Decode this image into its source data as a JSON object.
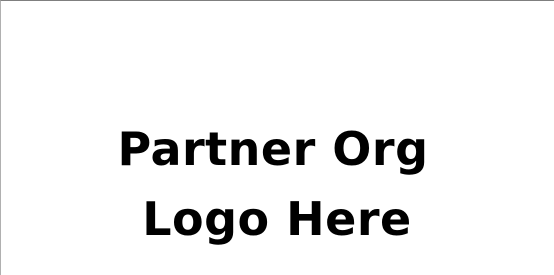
{
  "placeholder": {
    "line1": "Partner Org",
    "line2": "Logo Here"
  }
}
